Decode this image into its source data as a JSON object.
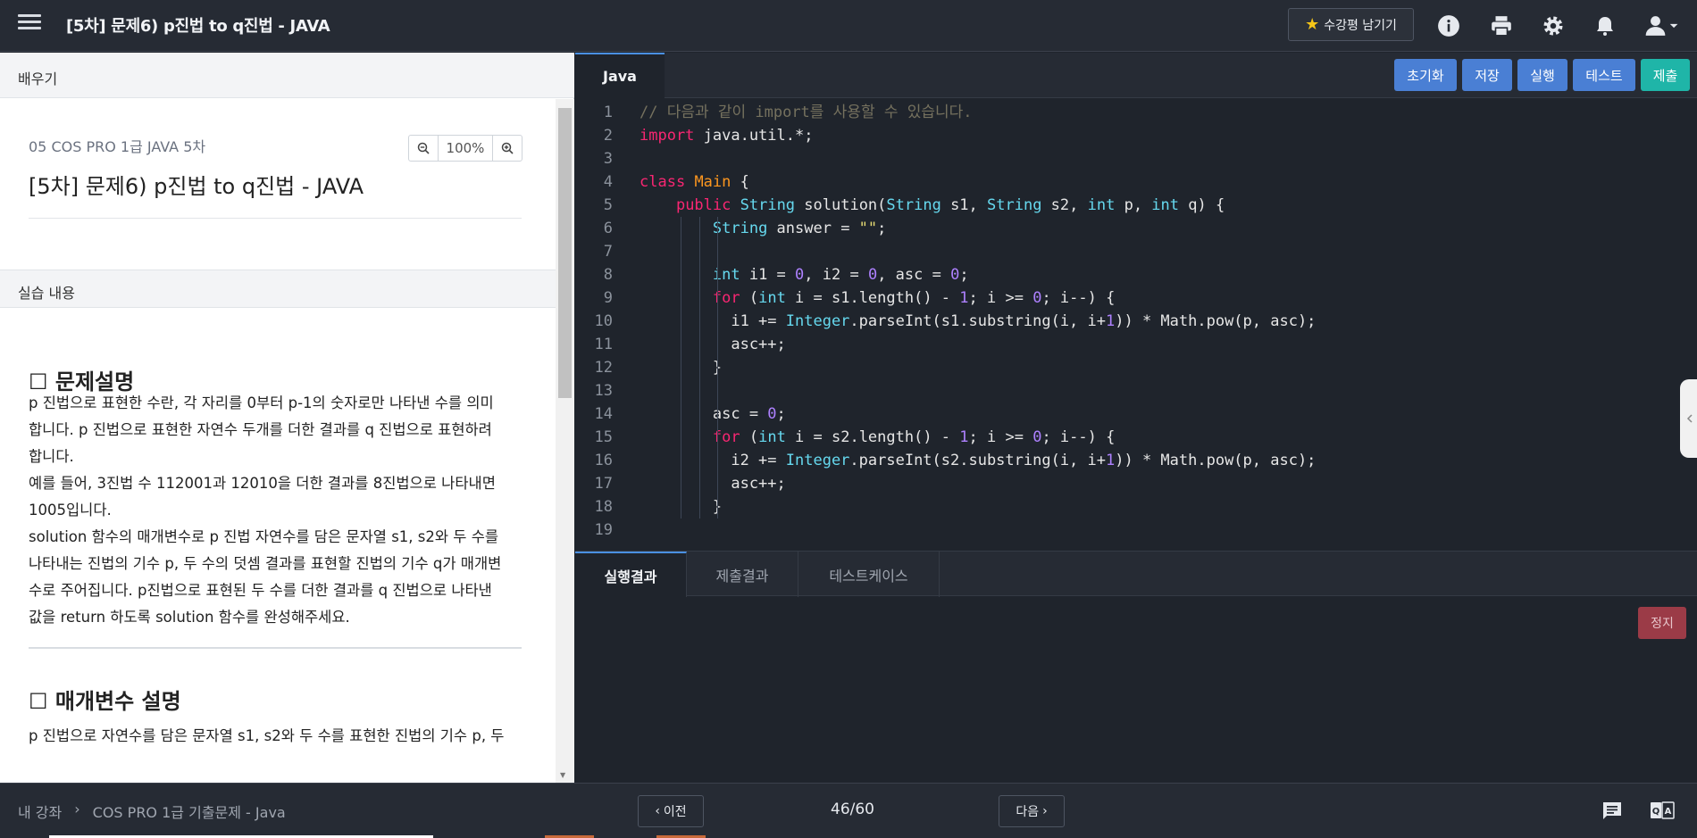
{
  "header": {
    "title": "[5차] 문제6) p진법 to q진법 - JAVA",
    "review_label": "수강평 남기기",
    "icons": [
      "info-icon",
      "print-icon",
      "gear-icon",
      "bell-icon",
      "user-icon"
    ]
  },
  "left": {
    "learn_label": "배우기",
    "course": "05 COS PRO 1급 JAVA 5차",
    "zoom": "100%",
    "title": "[5차] 문제6) p진법 to q진법 - JAVA",
    "practice_label": "실습 내용",
    "section1": "☐ 문제설명",
    "desc_lines": [
      "p 진법으로 표현한 수란, 각 자리를 0부터 p-1의 숫자로만 나타낸 수를 의미",
      "합니다. p 진법으로 표현한 자연수 두개를 더한 결과를 q 진법으로 표현하려",
      "합니다.",
      "예를 들어, 3진법 수 112001과 12010을 더한 결과를 8진법으로 나타내면",
      "1005입니다.",
      "solution 함수의 매개변수로 p 진법 자연수를 담은 문자열 s1, s2와 두 수를",
      "나타내는 진법의 기수 p, 두 수의 덧셈 결과를 표현할 진법의 기수 q가 매개변",
      "수로 주어집니다. p진법으로 표현된 두 수를 더한 결과를 q 진법으로 나타낸",
      "값을 return 하도록 solution 함수를 완성해주세요."
    ],
    "section2": "☐ 매개변수 설명",
    "param_line": "p 진법으로 자연수를 담은 문자열 s1, s2와 두 수를 표현한 진법의 기수 p, 두"
  },
  "editor": {
    "tab": "Java",
    "buttons": {
      "reset": "초기화",
      "save": "저장",
      "run": "실행",
      "test": "테스트",
      "submit": "제출"
    },
    "colors": {
      "blue_button": "#4a7fd4",
      "submit_button": "#1fb5a8",
      "stop_button": "#9b3b47"
    },
    "line_numbers": [
      "1",
      "2",
      "3",
      "4",
      "5",
      "6",
      "7",
      "8",
      "9",
      "10",
      "11",
      "12",
      "13",
      "14",
      "15",
      "16",
      "17",
      "18",
      "19"
    ],
    "code_lines": [
      "// 다음과 같이 import를 사용할 수 있습니다.",
      "import java.util.*;",
      "",
      "class Main {",
      "    public String solution(String s1, String s2, int p, int q) {",
      "        String answer = \"\";",
      "",
      "        int i1 = 0, i2 = 0, asc = 0;",
      "        for (int i = s1.length() - 1; i >= 0; i--) {",
      "          i1 += Integer.parseInt(s1.substring(i, i+1)) * Math.pow(p, asc);",
      "          asc++;",
      "        }",
      "",
      "        asc = 0;",
      "        for (int i = s2.length() - 1; i >= 0; i--) {",
      "          i2 += Integer.parseInt(s2.substring(i, i+1)) * Math.pow(p, asc);",
      "          asc++;",
      "        }",
      ""
    ]
  },
  "results": {
    "tabs": [
      "실행결과",
      "제출결과",
      "테스트케이스"
    ],
    "stop_label": "정지"
  },
  "footer": {
    "crumb_home": "내 강좌",
    "crumb_sep": "›",
    "crumb_course": "COS PRO 1급 기출문제 - Java",
    "prev_label": "이전",
    "next_label": "다음",
    "page": "46/60"
  }
}
